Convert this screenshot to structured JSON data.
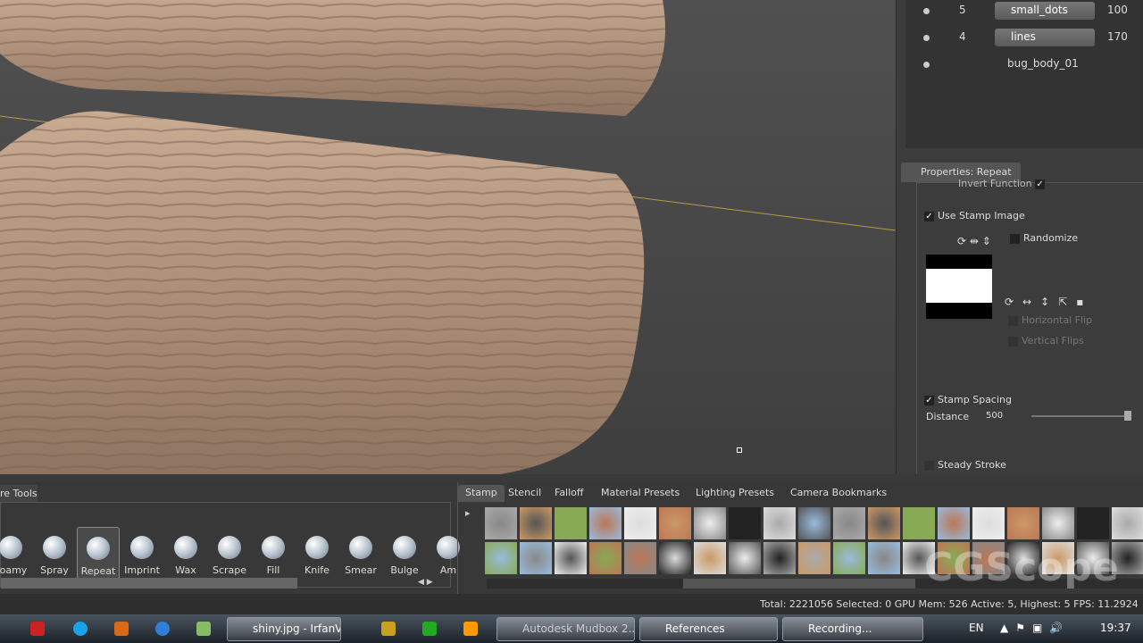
{
  "layers": [
    {
      "num": "5",
      "name": "small_dots",
      "value": "100"
    },
    {
      "num": "4",
      "name": "lines",
      "value": "170"
    },
    {
      "name": "bug_body_01"
    }
  ],
  "properties": {
    "tab": "Properties: Repeat",
    "invert_function": "Invert Function",
    "use_stamp_image": "Use Stamp Image",
    "randomize": "Randomize",
    "horizontal_flip": "Horizontal Flip",
    "vertical_flips": "Vertical Flips",
    "stamp_spacing": "Stamp Spacing",
    "distance_label": "Distance",
    "distance_value": "500",
    "distance_fraction": 1.0,
    "steady_stroke": "Steady Stroke"
  },
  "tools": {
    "tab": "re Tools",
    "items": [
      "Foamy",
      "Spray",
      "Repeat",
      "Imprint",
      "Wax",
      "Scrape",
      "Fill",
      "Knife",
      "Smear",
      "Bulge",
      "Am"
    ],
    "selected": "Repeat"
  },
  "lib_tabs": [
    "Stamp",
    "Stencil",
    "Falloff",
    "Material Presets",
    "Lighting Presets",
    "Camera Bookmarks"
  ],
  "status": "Total: 2221056  Selected: 0 GPU Mem: 526  Active: 5, Highest: 5  FPS: 11.2924",
  "watermark": "CGScope SCHOOL",
  "taskbar": {
    "windows": [
      "shiny.jpg - IrfanView",
      "Autodesk Mudbox 2...",
      "References",
      "Recording..."
    ],
    "lang": "EN",
    "clock": "19:37"
  }
}
